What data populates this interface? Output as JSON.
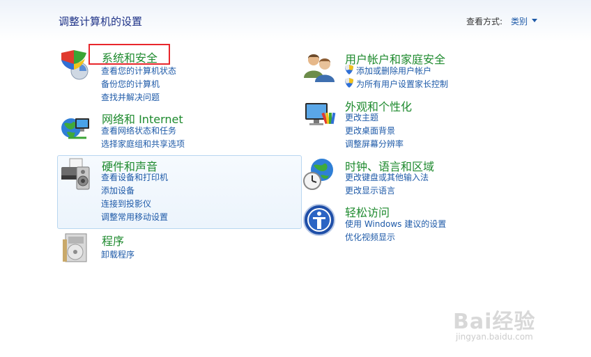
{
  "header": {
    "title": "调整计算机的设置",
    "view_by_label": "查看方式:",
    "view_by_value": "类别"
  },
  "categories": {
    "system_security": {
      "title": "系统和安全",
      "links": [
        "查看您的计算机状态",
        "备份您的计算机",
        "查找并解决问题"
      ],
      "icon": "shield-icon"
    },
    "network": {
      "title": "网络和 Internet",
      "links": [
        "查看网络状态和任务",
        "选择家庭组和共享选项"
      ],
      "icon": "globe-network-icon"
    },
    "hardware_sound": {
      "title": "硬件和声音",
      "links": [
        "查看设备和打印机",
        "添加设备",
        "连接到投影仪",
        "调整常用移动设置"
      ],
      "icon": "printer-speaker-icon"
    },
    "programs": {
      "title": "程序",
      "links": [
        "卸载程序"
      ],
      "icon": "programs-icon"
    },
    "user_accounts": {
      "title": "用户帐户和家庭安全",
      "links": [
        "添加或删除用户帐户",
        "为所有用户设置家长控制"
      ],
      "icon": "users-icon"
    },
    "appearance": {
      "title": "外观和个性化",
      "links": [
        "更改主题",
        "更改桌面背景",
        "调整屏幕分辨率"
      ],
      "icon": "monitor-palette-icon"
    },
    "clock_region": {
      "title": "时钟、语言和区域",
      "links": [
        "更改键盘或其他输入法",
        "更改显示语言"
      ],
      "icon": "clock-globe-icon"
    },
    "ease_access": {
      "title": "轻松访问",
      "links": [
        "使用 Windows 建议的设置",
        "优化视频显示"
      ],
      "icon": "ease-of-access-icon"
    }
  },
  "watermark": {
    "logo": "Bai经验",
    "url": "jingyan.baidu.com"
  }
}
